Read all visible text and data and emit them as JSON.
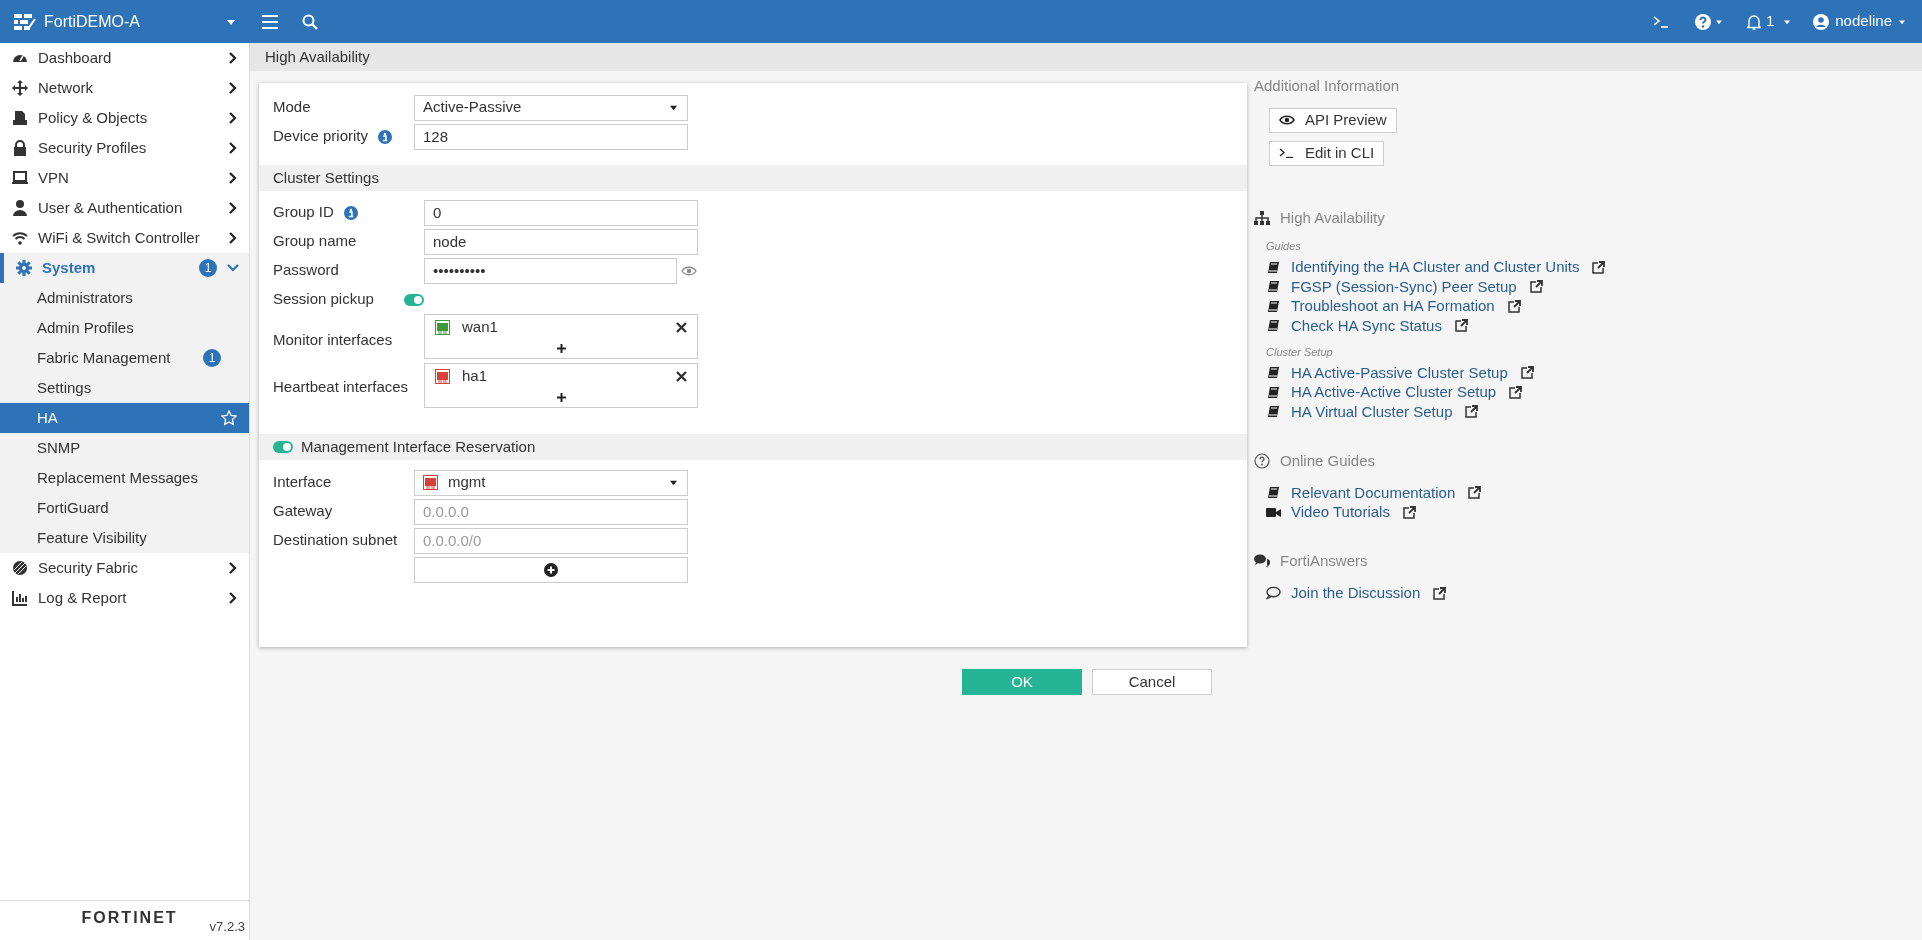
{
  "topbar": {
    "device": "FortiDEMO-A",
    "notifications": "1",
    "user": "nodeline"
  },
  "sidebar": {
    "items": [
      {
        "label": "Dashboard",
        "expanded": false
      },
      {
        "label": "Network",
        "expanded": false
      },
      {
        "label": "Policy & Objects",
        "expanded": false
      },
      {
        "label": "Security Profiles",
        "expanded": false
      },
      {
        "label": "VPN",
        "expanded": false
      },
      {
        "label": "User & Authentication",
        "expanded": false
      },
      {
        "label": "WiFi & Switch Controller",
        "expanded": false
      },
      {
        "label": "System",
        "expanded": true,
        "badge": "1",
        "children": [
          {
            "label": "Administrators",
            "selected": false
          },
          {
            "label": "Admin Profiles",
            "selected": false
          },
          {
            "label": "Fabric Management",
            "selected": false,
            "badge": "1"
          },
          {
            "label": "Settings",
            "selected": false
          },
          {
            "label": "HA",
            "selected": true
          },
          {
            "label": "SNMP",
            "selected": false
          },
          {
            "label": "Replacement Messages",
            "selected": false
          },
          {
            "label": "FortiGuard",
            "selected": false
          },
          {
            "label": "Feature Visibility",
            "selected": false
          }
        ]
      },
      {
        "label": "Security Fabric",
        "expanded": false
      },
      {
        "label": "Log & Report",
        "expanded": false
      }
    ],
    "logo": "FORTINET",
    "version": "v7.2.3"
  },
  "page_title": "High Availability",
  "form": {
    "mode": {
      "label": "Mode",
      "value": "Active-Passive"
    },
    "device_priority": {
      "label": "Device priority",
      "value": "128"
    },
    "cluster_settings": {
      "title": "Cluster Settings",
      "group_id": {
        "label": "Group ID",
        "value": "0"
      },
      "group_name": {
        "label": "Group name",
        "value": "node"
      },
      "password": {
        "label": "Password",
        "value": "••••••••••"
      },
      "session_pickup": {
        "label": "Session pickup",
        "on": true
      },
      "monitor_interfaces": {
        "label": "Monitor interfaces",
        "items": [
          {
            "name": "wan1",
            "color": "#3a9a3a"
          }
        ]
      },
      "heartbeat_interfaces": {
        "label": "Heartbeat interfaces",
        "items": [
          {
            "name": "ha1",
            "color": "#d9403a"
          }
        ]
      }
    },
    "management_reservation": {
      "title": "Management Interface Reservation",
      "on": true,
      "interface": {
        "label": "Interface",
        "value": "mgmt",
        "color": "#d9403a"
      },
      "gateway": {
        "label": "Gateway",
        "placeholder": "0.0.0.0"
      },
      "destination_subnet": {
        "label": "Destination subnet",
        "placeholder": "0.0.0.0/0"
      }
    }
  },
  "buttons": [
    {
      "label": "OK",
      "kind": "primary"
    },
    {
      "label": "Cancel",
      "kind": "secondary"
    }
  ],
  "info_panel": {
    "title": "Additional Information",
    "actions": [
      {
        "label": "API Preview",
        "kind": "preview"
      },
      {
        "label": "Edit in CLI",
        "kind": "cli"
      }
    ],
    "sections": [
      {
        "title": "High Availability",
        "kind": "topology",
        "groups": [
          {
            "heading": "Guides",
            "links": [
              {
                "label": "Identifying the HA Cluster and Cluster Units",
                "kind": "doc"
              },
              {
                "label": "FGSP (Session-Sync) Peer Setup",
                "kind": "doc"
              },
              {
                "label": "Troubleshoot an HA Formation",
                "kind": "doc"
              },
              {
                "label": "Check HA Sync Status",
                "kind": "doc"
              }
            ]
          },
          {
            "heading": "Cluster Setup",
            "links": [
              {
                "label": "HA Active-Passive Cluster Setup",
                "kind": "doc"
              },
              {
                "label": "HA Active-Active Cluster Setup",
                "kind": "doc"
              },
              {
                "label": "HA Virtual Cluster Setup",
                "kind": "doc"
              }
            ]
          }
        ]
      },
      {
        "title": "Online Guides",
        "kind": "help",
        "groups": [
          {
            "links": [
              {
                "label": "Relevant Documentation",
                "kind": "doc"
              },
              {
                "label": "Video Tutorials",
                "kind": "video"
              }
            ]
          }
        ]
      },
      {
        "title": "FortiAnswers",
        "kind": "chat",
        "groups": [
          {
            "links": [
              {
                "label": "Join the Discussion",
                "kind": "discussion"
              }
            ]
          }
        ]
      }
    ]
  }
}
